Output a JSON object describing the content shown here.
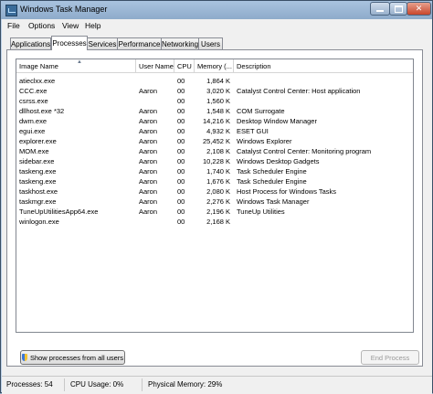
{
  "window": {
    "title": "Windows Task Manager"
  },
  "menu": [
    "File",
    "Options",
    "View",
    "Help"
  ],
  "tabs": [
    "Applications",
    "Processes",
    "Services",
    "Performance",
    "Networking",
    "Users"
  ],
  "active_tab": "Processes",
  "columns": [
    "Image Name",
    "User Name",
    "CPU",
    "Memory (...",
    "Description"
  ],
  "processes": [
    {
      "name": "atieclxx.exe",
      "user": "",
      "cpu": "00",
      "mem": "1,864 K",
      "desc": ""
    },
    {
      "name": "CCC.exe",
      "user": "Aaron",
      "cpu": "00",
      "mem": "3,020 K",
      "desc": "Catalyst Control Center: Host application"
    },
    {
      "name": "csrss.exe",
      "user": "",
      "cpu": "00",
      "mem": "1,560 K",
      "desc": ""
    },
    {
      "name": "dllhost.exe *32",
      "user": "Aaron",
      "cpu": "00",
      "mem": "1,548 K",
      "desc": "COM Surrogate"
    },
    {
      "name": "dwm.exe",
      "user": "Aaron",
      "cpu": "00",
      "mem": "14,216 K",
      "desc": "Desktop Window Manager"
    },
    {
      "name": "egui.exe",
      "user": "Aaron",
      "cpu": "00",
      "mem": "4,932 K",
      "desc": "ESET GUI"
    },
    {
      "name": "explorer.exe",
      "user": "Aaron",
      "cpu": "00",
      "mem": "25,452 K",
      "desc": "Windows Explorer"
    },
    {
      "name": "MOM.exe",
      "user": "Aaron",
      "cpu": "00",
      "mem": "2,108 K",
      "desc": "Catalyst Control Center: Monitoring program"
    },
    {
      "name": "sidebar.exe",
      "user": "Aaron",
      "cpu": "00",
      "mem": "10,228 K",
      "desc": "Windows Desktop Gadgets"
    },
    {
      "name": "taskeng.exe",
      "user": "Aaron",
      "cpu": "00",
      "mem": "1,740 K",
      "desc": "Task Scheduler Engine"
    },
    {
      "name": "taskeng.exe",
      "user": "Aaron",
      "cpu": "00",
      "mem": "1,676 K",
      "desc": "Task Scheduler Engine"
    },
    {
      "name": "taskhost.exe",
      "user": "Aaron",
      "cpu": "00",
      "mem": "2,080 K",
      "desc": "Host Process for Windows Tasks"
    },
    {
      "name": "taskmgr.exe",
      "user": "Aaron",
      "cpu": "00",
      "mem": "2,276 K",
      "desc": "Windows Task Manager"
    },
    {
      "name": "TuneUpUtilitiesApp64.exe",
      "user": "Aaron",
      "cpu": "00",
      "mem": "2,196 K",
      "desc": "TuneUp Utilities"
    },
    {
      "name": "winlogon.exe",
      "user": "",
      "cpu": "00",
      "mem": "2,168 K",
      "desc": ""
    }
  ],
  "buttons": {
    "show_all": "Show processes from all users",
    "end_process": "End Process"
  },
  "status": {
    "processes": "Processes: 54",
    "cpu": "CPU Usage: 0%",
    "memory": "Physical Memory: 29%"
  },
  "icons": {
    "app": "task-manager-icon",
    "uac": "shield-icon"
  },
  "colors": {
    "title_bar": "#8eabcb",
    "close_button": "#c8462c"
  }
}
